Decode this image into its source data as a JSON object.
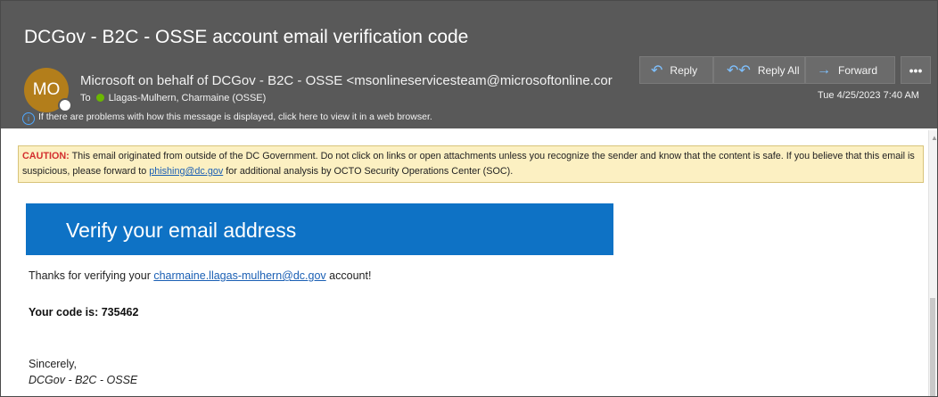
{
  "message": {
    "subject": "DCGov - B2C - OSSE account email verification code",
    "avatar_initials": "MO",
    "from": "Microsoft on behalf of DCGov - B2C - OSSE <msonlineservicesteam@microsoftonline.cor",
    "to_prefix": "To",
    "to_name": "Llagas-Mulhern, Charmaine (OSSE)",
    "info_text": "If there are problems with how this message is displayed, click here to view it in a web browser.",
    "date": "Tue 4/25/2023 7:40 AM"
  },
  "actions": {
    "reply_label": "Reply",
    "reply_all_label": "Reply All",
    "forward_label": "Forward",
    "more_label": "•••"
  },
  "caution": {
    "label": "CAUTION:",
    "text_before": " This email originated from outside of the DC Government. Do not click on links or open attachments unless you recognize the sender and know that the content is safe. If you believe that this email is suspicious, please forward to ",
    "link": "phishing@dc.gov",
    "text_after": " for additional analysis by OCTO Security Operations Center (SOC)."
  },
  "body": {
    "banner_title": "Verify your email address",
    "thanks_before": "Thanks for verifying your ",
    "email_link": "charmaine.llagas-mulhern@dc.gov",
    "thanks_after": " account!",
    "code_line": "Your code is: 735462",
    "sincerely": "Sincerely,",
    "signature": "DCGov - B2C - OSSE"
  },
  "colors": {
    "header_bg": "#595959",
    "avatar_bg": "#b37e1b",
    "banner_bg": "#0e72c5",
    "caution_bg": "#fcf0c2",
    "link": "#1a5fb4",
    "accent_icon": "#7fc1ff"
  },
  "icons": {
    "reply": "reply-arrow-icon",
    "reply_all": "reply-all-arrow-icon",
    "forward": "forward-arrow-icon",
    "info": "info-circle-icon",
    "presence": "presence-status-icon",
    "recipient_status": "recipient-check-icon"
  }
}
